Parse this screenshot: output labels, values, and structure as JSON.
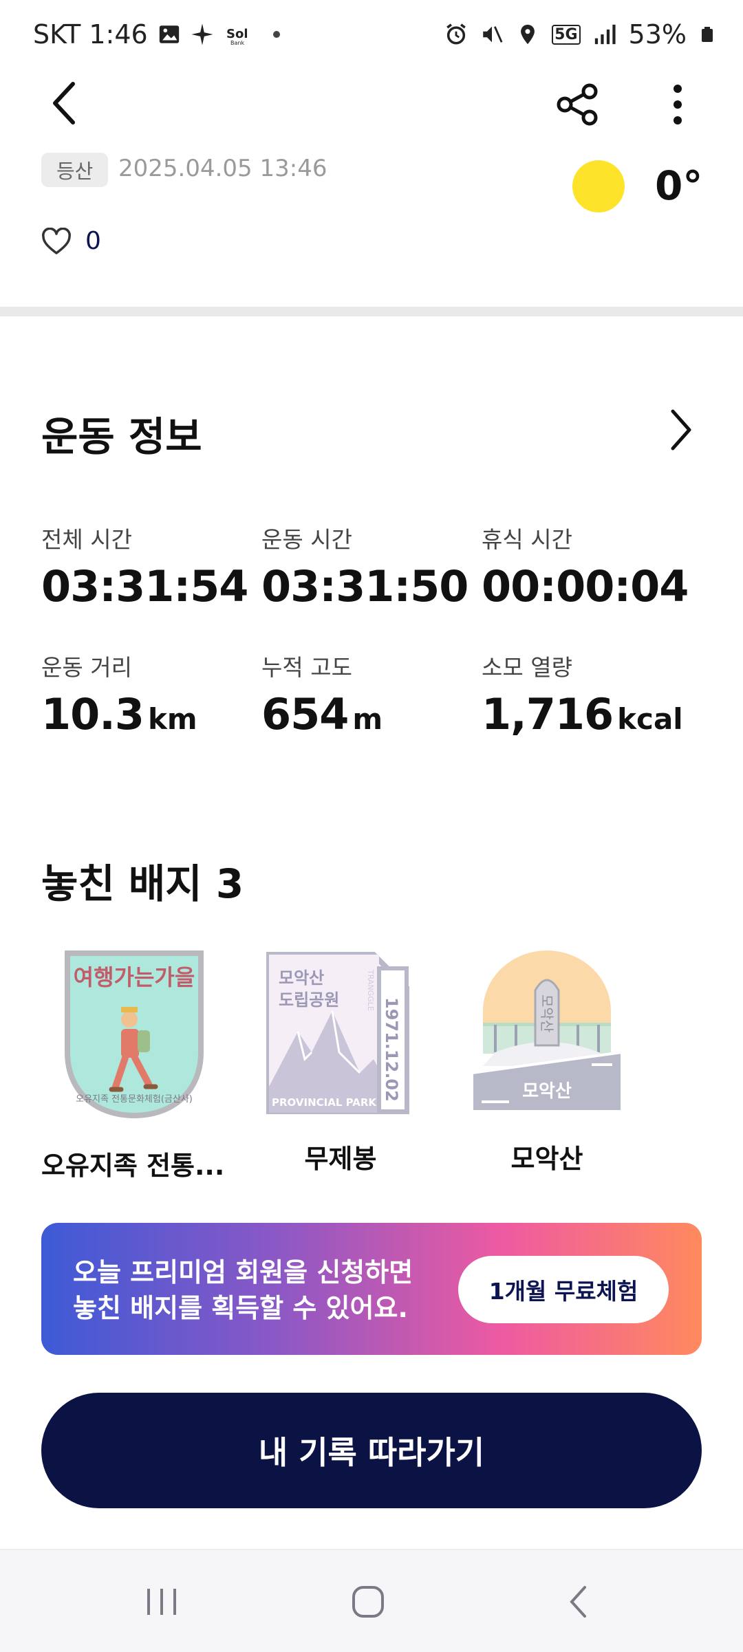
{
  "status_bar": {
    "carrier_time": "SKT 1:46",
    "battery": "53%",
    "network": "5G"
  },
  "header": {
    "activity_tag": "등산",
    "datetime": "2025.04.05 13:46",
    "temperature": "0°",
    "like_count": "0"
  },
  "exercise_info": {
    "title": "운동 정보",
    "metrics": [
      {
        "label": "전체 시간",
        "value": "03:31:54",
        "unit": ""
      },
      {
        "label": "운동 시간",
        "value": "03:31:50",
        "unit": ""
      },
      {
        "label": "휴식 시간",
        "value": "00:00:04",
        "unit": ""
      },
      {
        "label": "운동 거리",
        "value": "10.3",
        "unit": "km"
      },
      {
        "label": "누적 고도",
        "value": "654",
        "unit": "m"
      },
      {
        "label": "소모 열량",
        "value": "1,716",
        "unit": "kcal"
      }
    ]
  },
  "badges": {
    "title": "놓친 배지 3",
    "items": [
      {
        "name": "오유지족 전통...",
        "badge_text": "여행가는가을",
        "badge_subtext": "오유지족 전통문화체험(금산사)"
      },
      {
        "name": "무제봉",
        "badge_text_1": "모악산",
        "badge_text_2": "도립공원",
        "badge_number": "1971.12.02",
        "badge_park": "PROVINCIAL PARK",
        "badge_side": "TRANGGLE"
      },
      {
        "name": "모악산",
        "badge_banner": "모악산",
        "badge_stone": "모악산"
      }
    ]
  },
  "promo": {
    "line1": "오늘 프리미엄 회원을 신청하면",
    "line2": "놓친 배지를 획득할 수 있어요.",
    "button": "1개월 무료체험"
  },
  "follow_button": "내 기록 따라가기",
  "colors": {
    "accent_navy": "#0b1244",
    "sun": "#fde32a",
    "promo_start": "#3d5ad6",
    "promo_end": "#ff8a5e"
  }
}
